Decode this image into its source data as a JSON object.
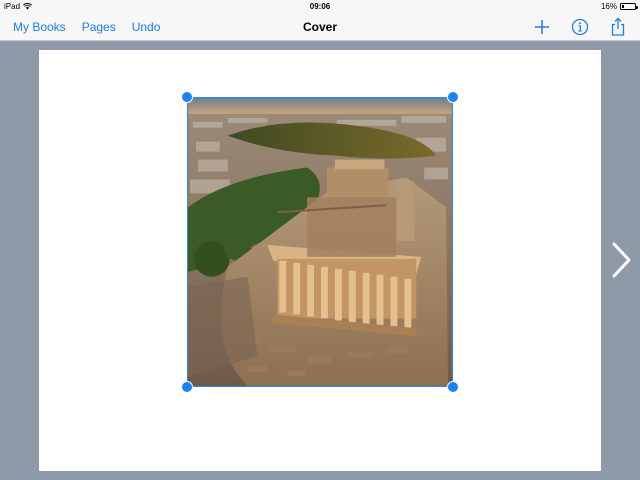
{
  "status_bar": {
    "device": "iPad",
    "time": "09:06",
    "battery": "16%",
    "battery_level": 0.16
  },
  "nav": {
    "my_books": "My Books",
    "pages": "Pages",
    "undo": "Undo",
    "title": "Cover",
    "icons": [
      "plus-icon",
      "info-icon",
      "share-icon"
    ]
  },
  "canvas": {
    "image": "aerial-photo-parthenon-acropolis",
    "next_icon": "chevron-right-icon"
  },
  "colors": {
    "accent": "#1a7cf5",
    "background": "#8e9aa8",
    "page": "#ffffff",
    "bar": "#f7f7f7"
  }
}
